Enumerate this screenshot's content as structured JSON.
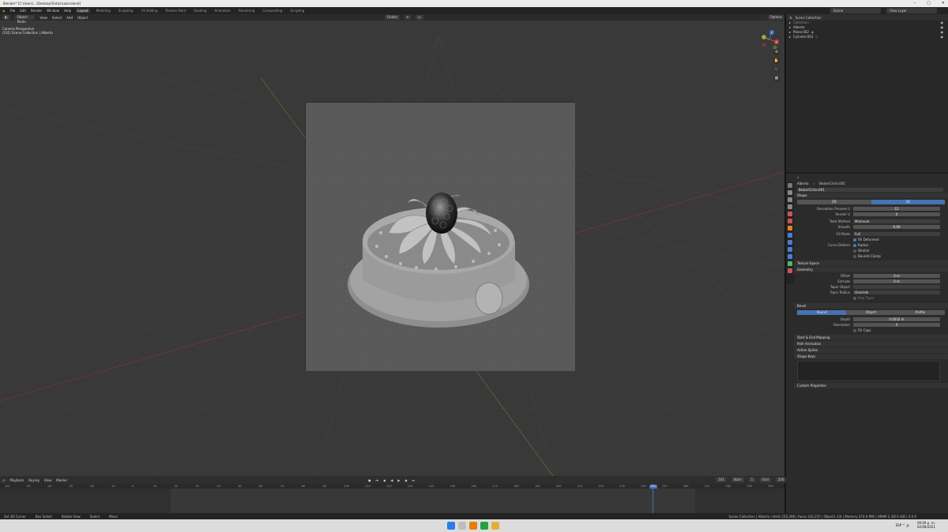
{
  "window": {
    "title": "Blender* [C:\\Users\\...\\Desktop\\Tortas\\cake.blend]",
    "controls": [
      "–",
      "▢",
      "✕"
    ]
  },
  "menubar": {
    "items": [
      "File",
      "Edit",
      "Render",
      "Window",
      "Help"
    ],
    "workspaces": [
      "Layout",
      "Modeling",
      "Sculpting",
      "UV Editing",
      "Texture Paint",
      "Shading",
      "Animation",
      "Rendering",
      "Compositing",
      "Scripting"
    ],
    "active_workspace": "Layout",
    "scene": "Scene",
    "view_layer": "View Layer"
  },
  "viewport": {
    "mode": "Object Mode",
    "menus": [
      "View",
      "Select",
      "Add",
      "Object"
    ],
    "transform": "Global",
    "options": "Options",
    "info_line1": "Camera Perspective",
    "info_line2": "(101) Scene Collection | Alberto",
    "gizmo_axes": {
      "x": "X",
      "y": "Y",
      "z": "Z"
    },
    "nav_icons": [
      "⊕",
      "✋",
      "🎥",
      "▦"
    ]
  },
  "outliner": {
    "header": "Scene Collection",
    "rows": [
      {
        "name": "Collection",
        "icon": "▸"
      },
      {
        "name": "Alberto",
        "icon": "▸"
      },
      {
        "name": "Plane.002",
        "icon": "▸"
      },
      {
        "name": "Cylinder.003",
        "icon": "▸"
      }
    ]
  },
  "properties": {
    "header_left": "Alberto",
    "header_right": "BezierCircle.001",
    "datablock": "BezierCircle.001",
    "sections": {
      "shape": "Shape",
      "texture_space": "Texture Space",
      "geometry": "Geometry",
      "bevel": "Bevel",
      "start_end": "Start & End Mapping",
      "path_animation": "Path Animation",
      "active_spline": "Active Spline",
      "shape_keys": "Shape Keys",
      "custom_properties": "Custom Properties"
    },
    "shape_tabs": [
      "2D",
      "3D"
    ],
    "shape_active": "3D",
    "shape_rows": [
      {
        "label": "Resolution Preview U",
        "value": "12"
      },
      {
        "label": "Render U",
        "value": "0"
      },
      {
        "label": "Twist Method",
        "value": "Minimum"
      },
      {
        "label": "Smooth",
        "value": "0.00"
      },
      {
        "label": "Fill Mode",
        "value": "Full"
      }
    ],
    "fill_deformed": "Fill Deformed",
    "curve_deform_label": "Curve Deform",
    "curve_deform_opts": [
      "Radius",
      "Stretch",
      "Bounds Clamp"
    ],
    "geometry_rows": [
      {
        "label": "Offset",
        "value": "0 m"
      },
      {
        "label": "Extrude",
        "value": "0 m"
      },
      {
        "label": "Taper Object",
        "value": ""
      },
      {
        "label": "Taper Radius",
        "value": "Override"
      }
    ],
    "map_taper": "Map Taper",
    "bevel_tabs": [
      "Round",
      "Object",
      "Profile"
    ],
    "bevel_active": "Round",
    "bevel_rows": [
      {
        "label": "Depth",
        "value": "0.0032 m"
      },
      {
        "label": "Resolution",
        "value": "4"
      }
    ],
    "fill_caps": "Fill Caps"
  },
  "timeline": {
    "menus": [
      "Playback",
      "Keying",
      "View",
      "Marker"
    ],
    "start_label": "Start",
    "start_value": "1",
    "end_label": "End",
    "end_value": "250",
    "current_frame": "101",
    "ruler": [
      "-60",
      "-50",
      "-40",
      "-30",
      "-20",
      "-10",
      "0",
      "10",
      "20",
      "30",
      "40",
      "50",
      "60",
      "70",
      "80",
      "90",
      "100",
      "110",
      "120",
      "130",
      "140",
      "150",
      "160",
      "170",
      "180",
      "190",
      "200",
      "210",
      "220",
      "230",
      "240",
      "250",
      "260",
      "270",
      "280",
      "290",
      "300"
    ]
  },
  "statusbar": {
    "items": [
      "Set 3D Cursor",
      "Box Select",
      "Rotate View",
      "Select",
      "Move"
    ],
    "stats": "Scene Collection | Alberto | Verts 233,308 | Faces 232,237 | Objects 1/4 | Memory 474.6 MiB | VRAM 2.3/6.0 GiB | 3.0.0"
  },
  "taskbar": {
    "time": "09:09 p. m.",
    "date": "02/08/2021",
    "tray": "ESP  ^  🔊"
  },
  "colors": {
    "accent": "#4772b3",
    "x_axis": "#c0433e",
    "y_axis": "#83a13a",
    "z_axis": "#3b6ed1"
  }
}
